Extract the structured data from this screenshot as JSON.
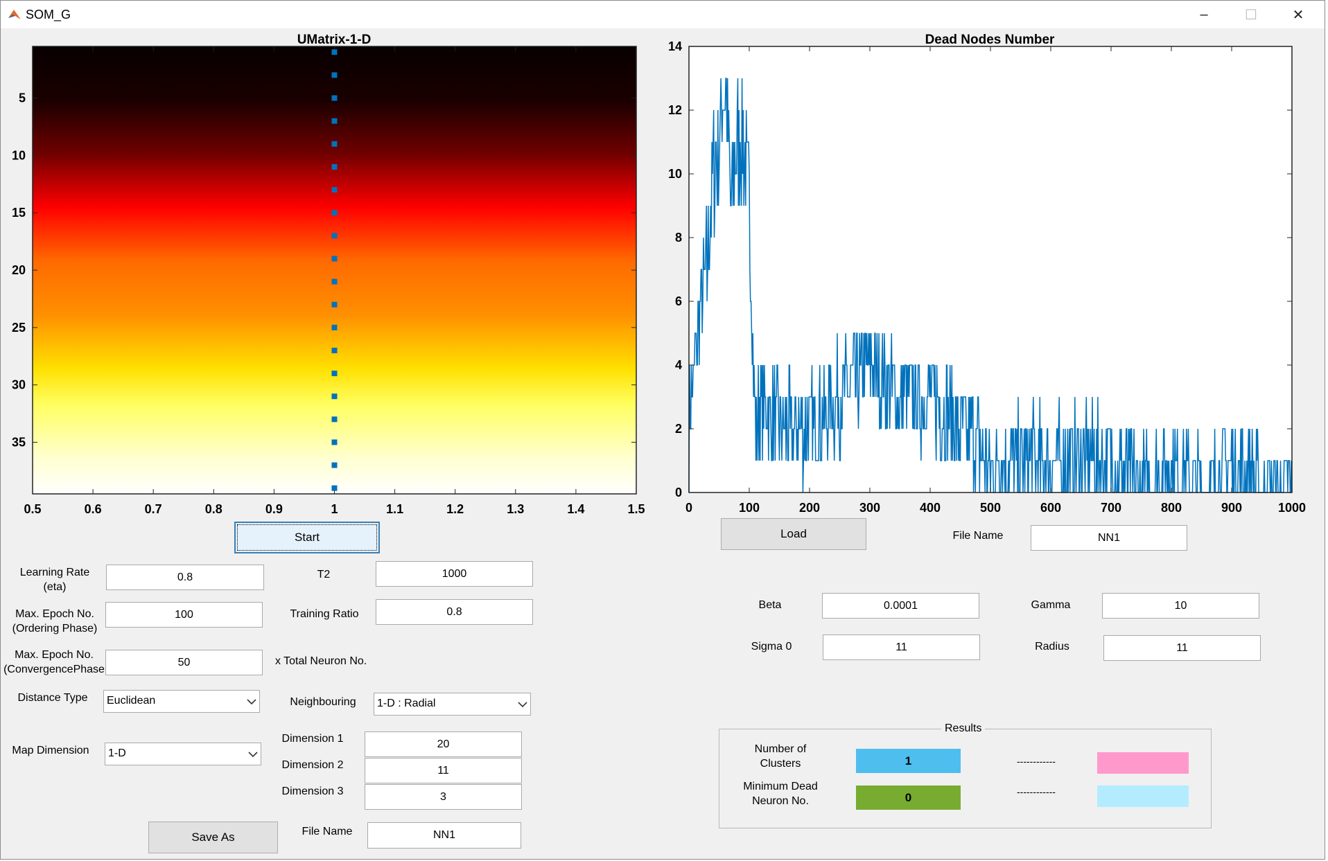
{
  "window": {
    "title": "SOM_G",
    "minimize": "–",
    "maximize": "☐",
    "close": "✕"
  },
  "umatrix": {
    "title": "UMatrix-1-D",
    "xticks": [
      "0.5",
      "0.6",
      "0.7",
      "0.8",
      "0.9",
      "1",
      "1.1",
      "1.2",
      "1.3",
      "1.4",
      "1.5"
    ],
    "yticks": [
      "5",
      "10",
      "15",
      "20",
      "25",
      "30",
      "35"
    ],
    "marker_color": "#0072bd"
  },
  "chart_data": {
    "type": "line",
    "title": "Dead Nodes Number",
    "xlabel": "",
    "ylabel": "",
    "xlim": [
      0,
      1000
    ],
    "ylim": [
      0,
      14
    ],
    "xticks": [
      "0",
      "100",
      "200",
      "300",
      "400",
      "500",
      "600",
      "700",
      "800",
      "900",
      "1000"
    ],
    "yticks": [
      "0",
      "2",
      "4",
      "6",
      "8",
      "10",
      "12",
      "14"
    ],
    "color": "#0072bd",
    "x": [
      0,
      10,
      20,
      30,
      40,
      50,
      60,
      70,
      80,
      90,
      100,
      110,
      120,
      150,
      200,
      250,
      300,
      350,
      400,
      450,
      500,
      550,
      600,
      650,
      700,
      750,
      800,
      850,
      900,
      950,
      1000
    ],
    "y": [
      2,
      4,
      6,
      7,
      10,
      11,
      13,
      9,
      11,
      11,
      9,
      2,
      3,
      2,
      2,
      3,
      4,
      3,
      3,
      2,
      1,
      1,
      1,
      1,
      1,
      0,
      1,
      0,
      1,
      0,
      0
    ]
  },
  "left_controls": {
    "start": "Start",
    "learning_rate_label": "Learning Rate (eta)",
    "learning_rate": "0.8",
    "t2_label": "T2",
    "t2": "1000",
    "max_epoch_ordering_label": "Max. Epoch No. (Ordering Phase)",
    "max_epoch_ordering": "100",
    "training_ratio_label": "Training Ratio",
    "training_ratio": "0.8",
    "max_epoch_conv_label": "Max. Epoch No. (ConvergencePhase",
    "max_epoch_conv": "50",
    "total_neuron_label": "x Total Neuron No.",
    "distance_type_label": "Distance Type",
    "distance_type": "Euclidean",
    "neighbouring_label": "Neighbouring",
    "neighbouring": "1-D : Radial",
    "map_dimension_label": "Map Dimension",
    "map_dimension": "1-D",
    "dimension1_label": "Dimension 1",
    "dimension1": "20",
    "dimension2_label": "Dimension 2",
    "dimension2": "11",
    "dimension3_label": "Dimension 3",
    "dimension3": "3",
    "save_as": "Save As",
    "file_name_label": "File Name",
    "file_name": "NN1"
  },
  "right_controls": {
    "load": "Load",
    "file_name_label": "File Name",
    "file_name": "NN1",
    "beta_label": "Beta",
    "beta": "0.0001",
    "gamma_label": "Gamma",
    "gamma": "10",
    "sigma0_label": "Sigma 0",
    "sigma0": "11",
    "radius_label": "Radius",
    "radius": "11"
  },
  "results": {
    "title": "Results",
    "clusters_label": "Number of Clusters",
    "clusters": "1",
    "min_dead_label": "Minimum Dead Neuron No.",
    "min_dead": "0",
    "dash1": "------------",
    "dash2": "------------",
    "colors": {
      "clusters": "#4dbeee",
      "min_dead": "#77ac30",
      "pink": "#ff99cc",
      "light_blue": "#b3ecff"
    }
  }
}
